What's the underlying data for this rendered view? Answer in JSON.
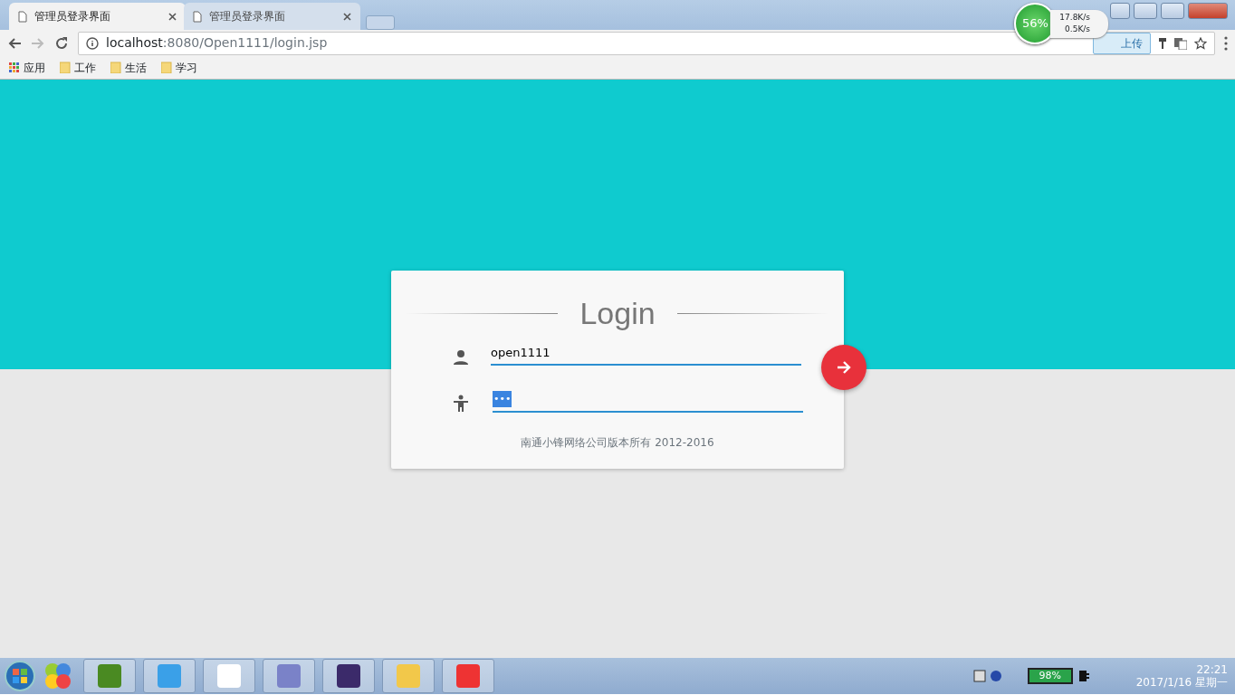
{
  "browser": {
    "tabs": [
      {
        "title": "管理员登录界面",
        "selected": true
      },
      {
        "title": "管理员登录界面",
        "selected": false
      }
    ],
    "address": {
      "host": "localhost",
      "path": ":8080/Open1111/login.jsp"
    },
    "bookmarks": [
      "应用",
      "工作",
      "生活",
      "学习"
    ],
    "upload_button": "上传",
    "net_widget": {
      "percent": "56%",
      "up": "17.8K/s",
      "down": "0.5K/s"
    }
  },
  "login": {
    "title": "Login",
    "username": {
      "value": "open1111"
    },
    "password": {
      "value": "•••",
      "selected_text": true
    },
    "footer": "南通小锋网络公司版本所有 2012-2016"
  },
  "taskbar": {
    "battery": "98%",
    "time": "22:21",
    "date": "2017/1/16 星期一"
  }
}
